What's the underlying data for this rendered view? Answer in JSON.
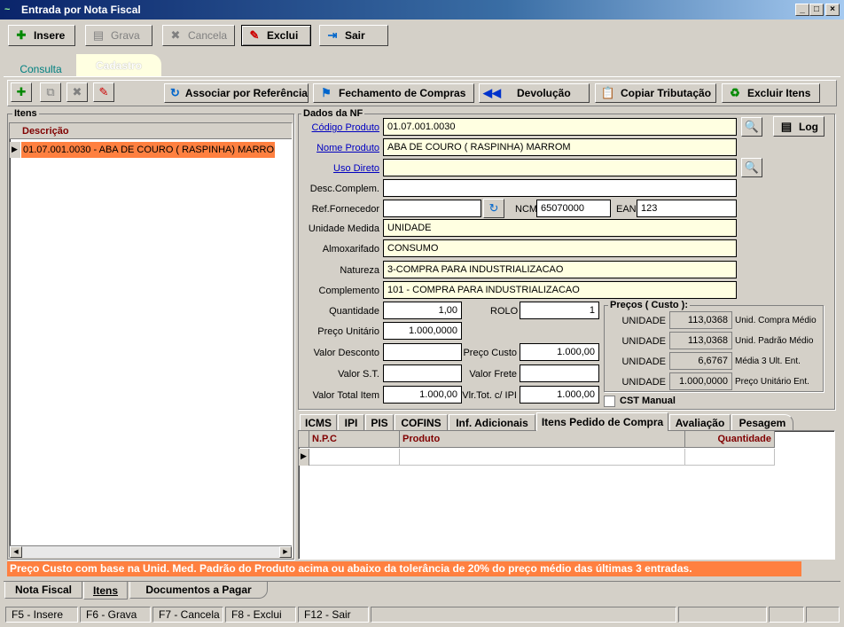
{
  "window": {
    "title": "Entrada por Nota Fiscal",
    "min": "_",
    "max": "□",
    "close": "×"
  },
  "toolbar": {
    "insere": "Insere",
    "grava": "Grava",
    "cancela": "Cancela",
    "exclui": "Exclui",
    "sair": "Sair"
  },
  "top_tabs": {
    "consulta": "Consulta",
    "cadastro": "Cadastro"
  },
  "action_bar": {
    "associar": "Associar por Referência",
    "fechamento": "Fechamento de Compras",
    "devolucao": "Devolução",
    "copiar": "Copiar Tributação",
    "excluir_itens": "Excluir Itens"
  },
  "itens_panel": {
    "title": "Itens",
    "column": "Descrição",
    "rows": [
      "01.07.001.0030 - ABA DE COURO ( RASPINHA) MARROM"
    ]
  },
  "dados": {
    "title": "Dados da NF",
    "codigo_produto_label": "Código Produto",
    "codigo_produto": "01.07.001.0030",
    "log_label": "Log",
    "nome_produto_label": "Nome Produto",
    "nome_produto": "ABA DE COURO ( RASPINHA) MARROM",
    "uso_direto_label": "Uso Direto",
    "uso_direto": "",
    "desc_complem_label": "Desc.Complem.",
    "desc_complem": "",
    "ref_fornecedor_label": "Ref.Fornecedor",
    "ref_fornecedor": "",
    "ncm_label": "NCM",
    "ncm": "65070000",
    "ean_label": "EAN",
    "ean": "123",
    "unidade_medida_label": "Unidade Medida",
    "unidade_medida": "UNIDADE",
    "almoxarifado_label": "Almoxarifado",
    "almoxarifado": "CONSUMO",
    "natureza_label": "Natureza",
    "natureza": "3-COMPRA PARA INDUSTRIALIZACAO",
    "complemento_label": "Complemento",
    "complemento": "101 - COMPRA PARA INDUSTRIALIZACAO",
    "quantidade_label": "Quantidade",
    "quantidade": "1,00",
    "rolo_label": "ROLO",
    "rolo": "1",
    "preco_unitario_label": "Preço Unitário",
    "preco_unitario": "1.000,0000",
    "valor_desconto_label": "Valor Desconto",
    "valor_desconto": "",
    "preco_custo_label": "Preço Custo",
    "preco_custo": "1.000,00",
    "valor_st_label": "Valor S.T.",
    "valor_st": "",
    "valor_frete_label": "Valor Frete",
    "valor_frete": "",
    "valor_total_item_label": "Valor Total Item",
    "valor_total_item": "1.000,00",
    "vlr_tot_ipi_label": "Vlr.Tot. c/ IPI",
    "vlr_tot_ipi": "1.000,00",
    "cst_manual_label": "CST Manual"
  },
  "precos": {
    "title": "Preços ( Custo ):",
    "rows": [
      {
        "unit": "UNIDADE",
        "value": "113,0368",
        "desc": "Unid. Compra Médio"
      },
      {
        "unit": "UNIDADE",
        "value": "113,0368",
        "desc": "Unid. Padrão Médio"
      },
      {
        "unit": "UNIDADE",
        "value": "6,6767",
        "desc": "Média 3 Ult. Ent."
      },
      {
        "unit": "UNIDADE",
        "value": "1.000,0000",
        "desc": "Preço Unitário Ent."
      }
    ]
  },
  "sub_tabs": [
    "ICMS",
    "IPI",
    "PIS",
    "COFINS",
    "Inf. Adicionais",
    "Itens Pedido de Compra",
    "Avaliação",
    "Pesagem"
  ],
  "grid": {
    "columns": [
      "N.P.C",
      "Produto",
      "Quantidade"
    ]
  },
  "warning": "Preço Custo com base na Unid. Med. Padrão do Produto acima ou abaixo da tolerância de 20% do preço médio das últimas 3 entradas.",
  "bottom_tabs": [
    "Nota Fiscal",
    "Itens",
    "Documentos a Pagar"
  ],
  "status": [
    "F5 - Insere",
    "F6 - Grava",
    "F7 - Cancela",
    "F8 - Exclui",
    "F12 - Sair"
  ],
  "colors": {
    "warning_bg": "#ff8040",
    "selected_row": "#ff8040",
    "title_start": "#0a246a",
    "column_header": "#800000"
  }
}
